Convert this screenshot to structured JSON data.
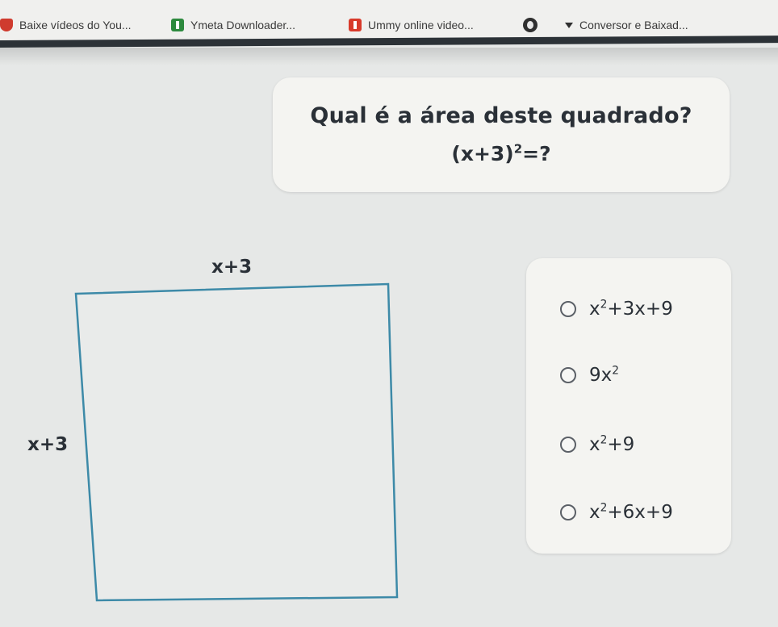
{
  "bookmarks": [
    {
      "label": "Baixe vídeos do You...",
      "icon": "shield-icon"
    },
    {
      "label": "Ymeta Downloader...",
      "icon": "download-icon"
    },
    {
      "label": "Ummy online video...",
      "icon": "video-icon"
    },
    {
      "label": "",
      "icon": "globe-icon"
    },
    {
      "label": "Conversor e Baixad...",
      "icon": "arrow-down-icon"
    }
  ],
  "question": {
    "title": "Qual é a área deste quadrado?",
    "expr_base": "(x+3)",
    "expr_exp": "2",
    "expr_tail": "=?"
  },
  "figure": {
    "top_label": "x+3",
    "side_label": "x+3"
  },
  "options": [
    {
      "parts": [
        "x",
        "2",
        "+3x+9"
      ]
    },
    {
      "parts": [
        "9x",
        "2",
        ""
      ]
    },
    {
      "parts": [
        "x",
        "2",
        "+9"
      ]
    },
    {
      "parts": [
        "x",
        "2",
        "+6x+9"
      ]
    }
  ],
  "colors": {
    "background": "#e6e8e7",
    "card": "#f4f4f1",
    "text": "#2a3037",
    "square_stroke": "#3d8aa8"
  }
}
